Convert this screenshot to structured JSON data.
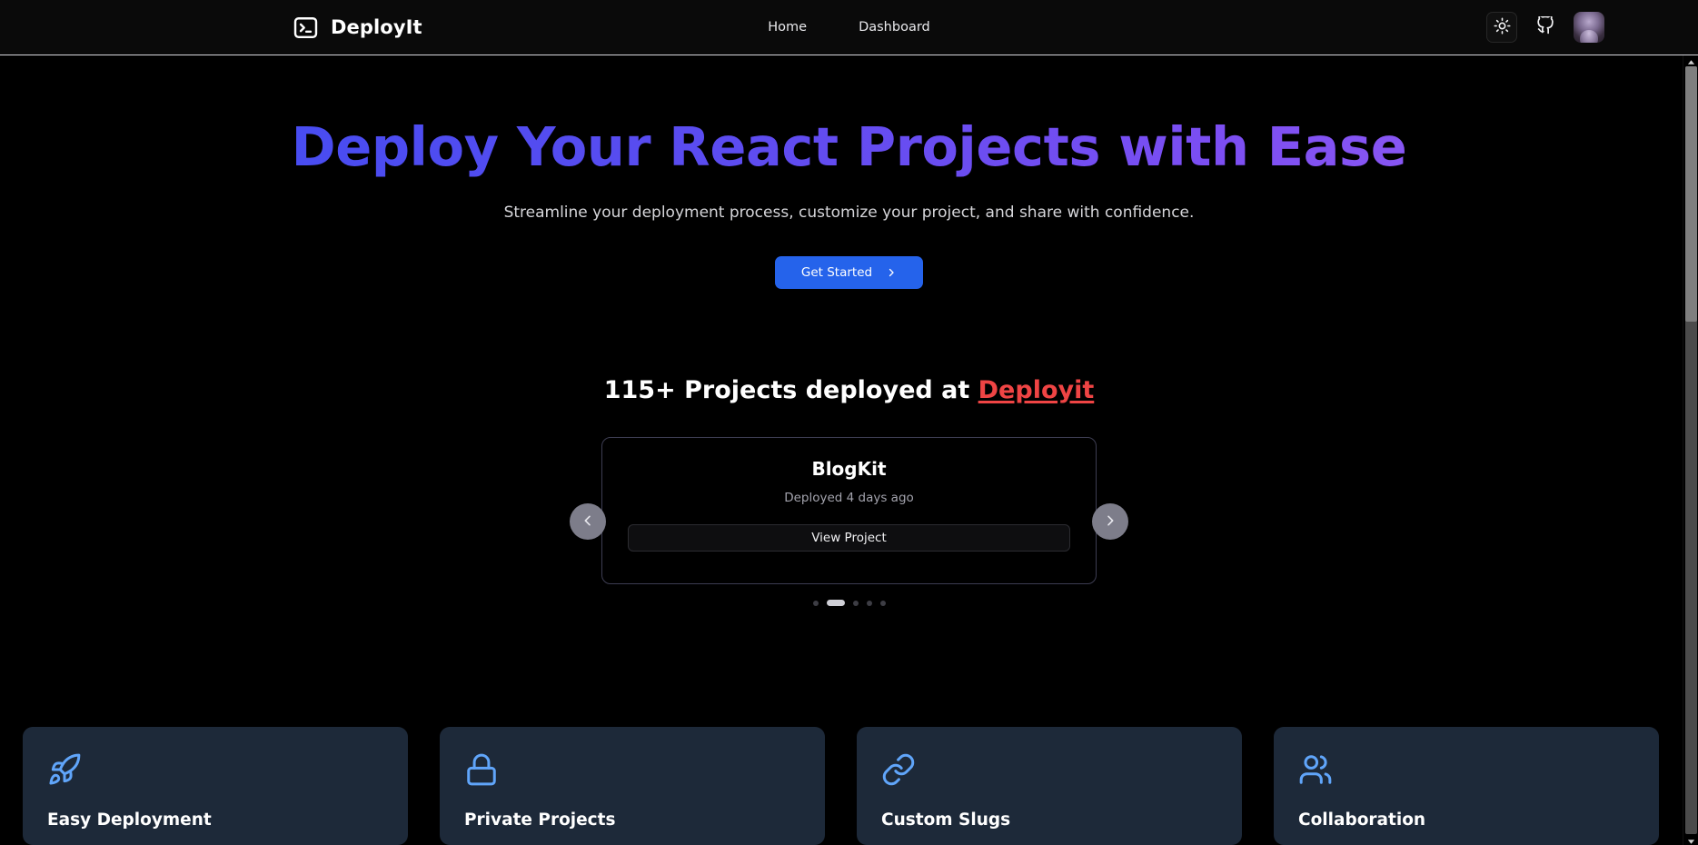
{
  "header": {
    "brand": {
      "name": "DeployIt",
      "icon": "terminal-icon"
    },
    "nav": [
      {
        "label": "Home"
      },
      {
        "label": "Dashboard"
      }
    ],
    "actions": {
      "theme_toggle_icon": "sun-icon",
      "github_icon": "github-icon",
      "avatar_icon": "user-avatar"
    }
  },
  "hero": {
    "title": "Deploy Your React Projects with Ease",
    "subtitle": "Streamline your deployment process, customize your project, and share with confidence.",
    "cta_label": "Get Started",
    "cta_icon": "chevron-right-icon",
    "title_gradient_from": "#3b4df2",
    "title_gradient_to": "#9a62f5",
    "cta_color": "#2563eb"
  },
  "projects": {
    "heading_prefix": "115+ Projects deployed at ",
    "heading_brand": "Deployit",
    "brand_color": "#ef4444",
    "carousel": {
      "prev_icon": "chevron-left-icon",
      "next_icon": "chevron-right-icon",
      "active_index": 1,
      "dot_count": 5,
      "card": {
        "title": "BlogKit",
        "meta": "Deployed 4 days ago",
        "action_label": "View Project"
      }
    }
  },
  "features": [
    {
      "title": "Easy Deployment",
      "icon": "rocket-icon",
      "icon_color": "#60a5fa"
    },
    {
      "title": "Private Projects",
      "icon": "lock-icon",
      "icon_color": "#60a5fa"
    },
    {
      "title": "Custom Slugs",
      "icon": "link-icon",
      "icon_color": "#60a5fa"
    },
    {
      "title": "Collaboration",
      "icon": "users-icon",
      "icon_color": "#60a5fa"
    }
  ],
  "scrollbar": {
    "up_icon": "caret-up-icon",
    "down_icon": "caret-down-icon"
  }
}
